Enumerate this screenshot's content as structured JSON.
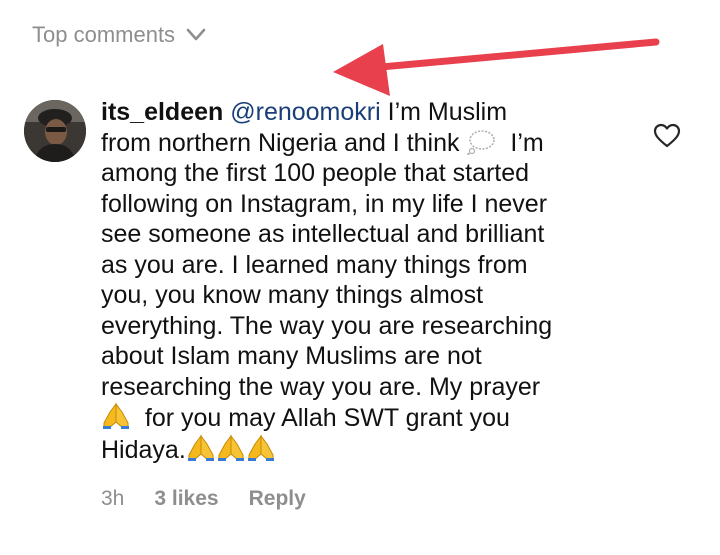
{
  "header": {
    "sort_label": "Top comments",
    "sort_icon": "chevron-down-icon"
  },
  "annotation": {
    "arrow_color": "#e8414d"
  },
  "comment": {
    "username": "its_eldeen",
    "mention": "@renoomokri",
    "lines": [
      "I’m Muslim",
      "from northern Nigeria and I think",
      "I’m",
      "among the first 100 people that started",
      "following on Instagram, in my life I never",
      "see someone as intellectual and brilliant",
      "as you are. I learned many things from",
      "you, you know many things almost",
      "everything. The way you are researching",
      "about Islam many Muslims are not",
      "researching the way you are. My prayer",
      "for you may Allah SWT grant you",
      "Hidaya."
    ],
    "emojis": {
      "thought": "thought-balloon-icon",
      "prayer": "folded-hands-icon"
    },
    "like_icon": "heart-outline-icon"
  },
  "meta": {
    "time": "3h",
    "likes": "3 likes",
    "reply": "Reply"
  },
  "colors": {
    "text": "#111111",
    "secondary": "#8e8e8e",
    "mention": "#1a3e78",
    "arrow": "#e8414d"
  }
}
